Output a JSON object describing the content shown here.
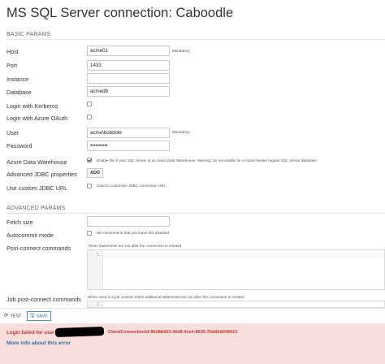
{
  "title": "MS SQL Server connection: Caboodle",
  "sections": {
    "basic": "BASIC PARAMS",
    "advanced": "ADVANCED PARAMS"
  },
  "fields": {
    "host": {
      "label": "Host",
      "value": "acme01",
      "hint": "Mandatory"
    },
    "port": {
      "label": "Port",
      "value": "1433"
    },
    "instance": {
      "label": "Instance",
      "value": ""
    },
    "database": {
      "label": "Database",
      "value": "acmedb"
    },
    "kerberos": {
      "label": "Login with Kerberos",
      "checked": false
    },
    "azure_oauth": {
      "label": "Login with Azure OAuth",
      "checked": false
    },
    "user": {
      "label": "User",
      "value": "acme\\bobdole",
      "hint": "Mandatory"
    },
    "password": {
      "label": "Password",
      "value": "••••••••••"
    },
    "azure_dw": {
      "label": "Azure Data Warehouse",
      "checked": true,
      "hint": "Enable this if your SQL Server is an Azure Data Warehouse. Warning: do not enable for a Azure-hosted regular SQL Server database"
    },
    "jdbc_props": {
      "label": "Advanced JDBC properties",
      "button": "ADD"
    },
    "custom_jdbc": {
      "label": "Use custom JDBC URL",
      "checked": false,
      "hint": "Used to customize JDBC connection URL"
    },
    "fetch_size": {
      "label": "Fetch size",
      "value": ""
    },
    "autocommit": {
      "label": "Autocommit mode",
      "checked": false,
      "hint": "We recommend that you leave this disabled"
    },
    "post_connect": {
      "label": "Post-connect commands",
      "hint": "These statements are run after the connection is created",
      "line_number": "1"
    },
    "job_post_connect": {
      "label": "Job post-connect commands",
      "hint": "When used in a job context, these additional statements are run after the connection is created",
      "line_number": "1"
    }
  },
  "toolbar": {
    "test_label": "TEST",
    "save_label": "SAVE"
  },
  "error": {
    "message": "Login failed for user",
    "connection_id": "ClientConnectionId:86d8b063-40d9-4ce4-8035-70dd0d049010",
    "link": "More info about this error"
  },
  "colors": {
    "error_bg": "#f9dede",
    "error_text": "#c0392b",
    "link": "#2a6ea0",
    "accent": "#4a90c2"
  }
}
